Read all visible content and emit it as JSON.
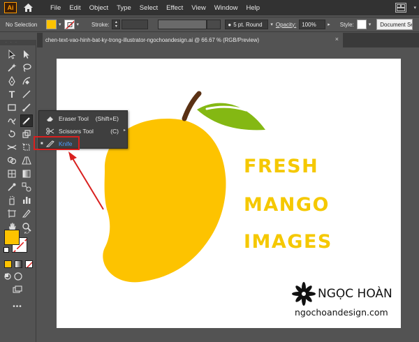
{
  "app": {
    "logo_text": "Ai",
    "menus": [
      "File",
      "Edit",
      "Object",
      "Type",
      "Select",
      "Effect",
      "View",
      "Window",
      "Help"
    ]
  },
  "control_bar": {
    "selection": "No Selection",
    "stroke_label": "Stroke:",
    "brush": "5 pt. Round",
    "opacity_label": "Opacity:",
    "opacity_value": "100%",
    "style_label": "Style:",
    "document_setup": "Document Se"
  },
  "document_tab": {
    "title": "chen-text-vao-hinh-bat-ky-trong-illustrator-ngochoandesign.ai @ 66.67 % (RGB/Preview)",
    "close": "×"
  },
  "flyout": {
    "items": [
      {
        "label": "Eraser Tool",
        "shortcut": "(Shift+E)",
        "icon": "eraser-icon"
      },
      {
        "label": "Scissors Tool",
        "shortcut": "(C)",
        "icon": "scissors-icon"
      },
      {
        "label": "Knife",
        "shortcut": "",
        "icon": "knife-icon"
      }
    ]
  },
  "artwork": {
    "headline": [
      "FRESH",
      "MANGO",
      "IMAGES"
    ],
    "brand_name": "NGỌC HOÀN",
    "brand_url": "ngochoandesign.com"
  },
  "colors": {
    "fill_swatch": "#fdc300",
    "mango": "#fdc300",
    "leaf": "#84b813",
    "stem": "#5a3114",
    "headline": "#f5c800",
    "annotation": "#d9201f",
    "highlight_text": "#4c9cff"
  }
}
